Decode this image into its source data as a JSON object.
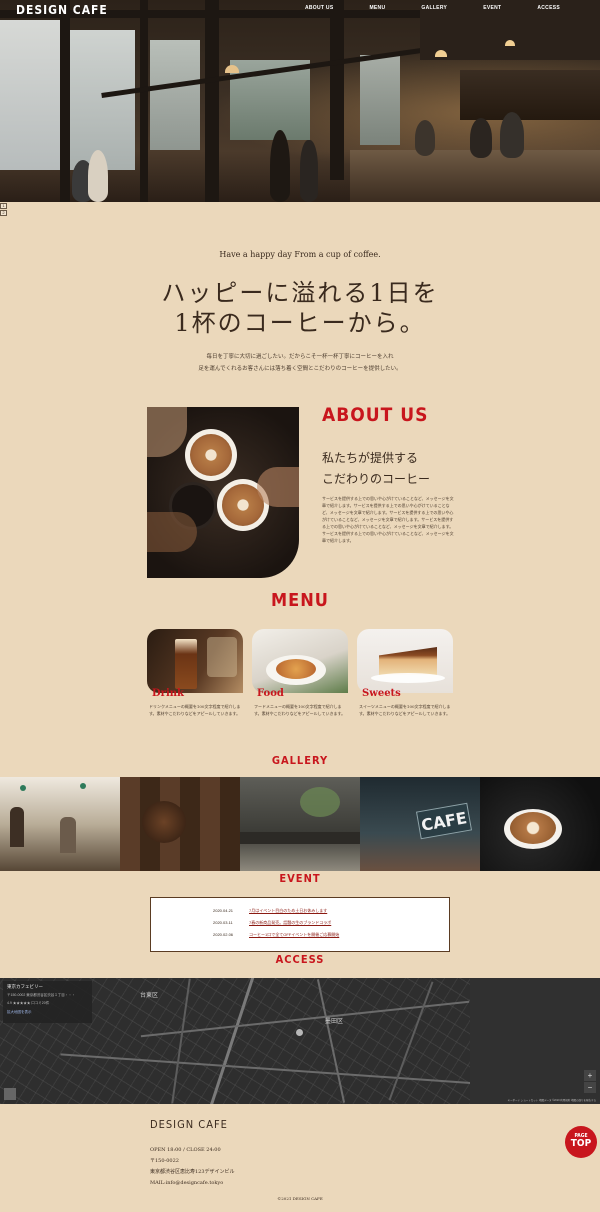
{
  "header": {
    "logo": "DESIGN CAFE",
    "nav": [
      "ABOUT US",
      "MENU",
      "GALLERY",
      "EVENT",
      "ACCESS"
    ]
  },
  "hero": {
    "image": "cafe-interior-photo"
  },
  "pager": [
    "1",
    "2"
  ],
  "intro": {
    "tagline": "Have a happy day From a cup of coffee.",
    "headline_line1": "ハッピーに溢れる1日を",
    "headline_line2": "1杯のコーヒーから。",
    "text_line1": "毎日を丁寧に大切に過ごしたい。だからこそ一杯一杯丁寧にコーヒーを入れ",
    "text_line2": "足を運んでくれるお客さんには落ち着く空間とこだわりのコーヒーを提供したい。"
  },
  "about": {
    "title": "ABOUT US",
    "subtitle_line1": "私たちが提供する",
    "subtitle_line2": "こだわりのコーヒー",
    "body": "サービスを提供する上での思いや心がけていることなど、メッセージを文章で紹介します。サービスを提供する上での思いや心がけていることなど、メッセージを文章で紹介します。サービスを提供する上での思いや心がけていることなど、メッセージを文章で紹介します。サービスを提供する上での思いや心がけていることなど、メッセージを文章で紹介します。サービスを提供する上での思いや心がけていることなど、メッセージを文章で紹介します。"
  },
  "menu": {
    "title": "MENU",
    "items": [
      {
        "name": "Drink",
        "desc": "ドリンクメニューの概要を100文字程度で紹介します。素材やこだわりなどをアピールしていきます。"
      },
      {
        "name": "Food",
        "desc": "フードメニューの概要を100文字程度で紹介します。素材やこだわりなどをアピールしていきます。"
      },
      {
        "name": "Sweets",
        "desc": "スイーツメニューの概要を100文字程度で紹介します。素材やこだわりなどをアピールしていきます。"
      }
    ]
  },
  "gallery": {
    "title": "GALLERY"
  },
  "event": {
    "title": "EVENT",
    "items": [
      {
        "date": "2020.04.21",
        "text": "7月はイベント目白のため土日お休みします"
      },
      {
        "date": "2020.03.11",
        "text": "7春の新商品発売。話題の生のブランドコラボ"
      },
      {
        "date": "2020.02.06",
        "text": "コーヒー1口で全てOFFイベントを開催ご応募開始"
      }
    ]
  },
  "access": {
    "title": "ACCESS",
    "map_card_name": "東京カフェビリー",
    "map_card_address": "〒150-0002 東京都渋谷区渋谷１丁目・・・",
    "map_card_rating": "4.9 ★★★★★ 口コミ20件",
    "map_card_link": "拡大地図を表示",
    "zoom_in": "+",
    "zoom_out": "−",
    "map_footer": "キーボード ショートカット  地図データ ©2020  利用規約  地図の誤りを報告する",
    "district_labels": [
      "台東区",
      "墨田区"
    ]
  },
  "footer": {
    "logo": "DESIGN CAFE",
    "hours": "OPEN 18:00 / CLOSE 24:00",
    "zip": "〒150-0022",
    "address": "東京都渋谷区恵比寿123デザインビル",
    "mail": "MAIL:info@designcafe.tokyo",
    "copyright": "©2021 DESIGN CAFE"
  },
  "pagetop": {
    "line1": "PAGE",
    "line2": "TOP"
  },
  "colors": {
    "background": "#ebd8bb",
    "accent": "#c8161d",
    "text": "#3a2a1e"
  }
}
